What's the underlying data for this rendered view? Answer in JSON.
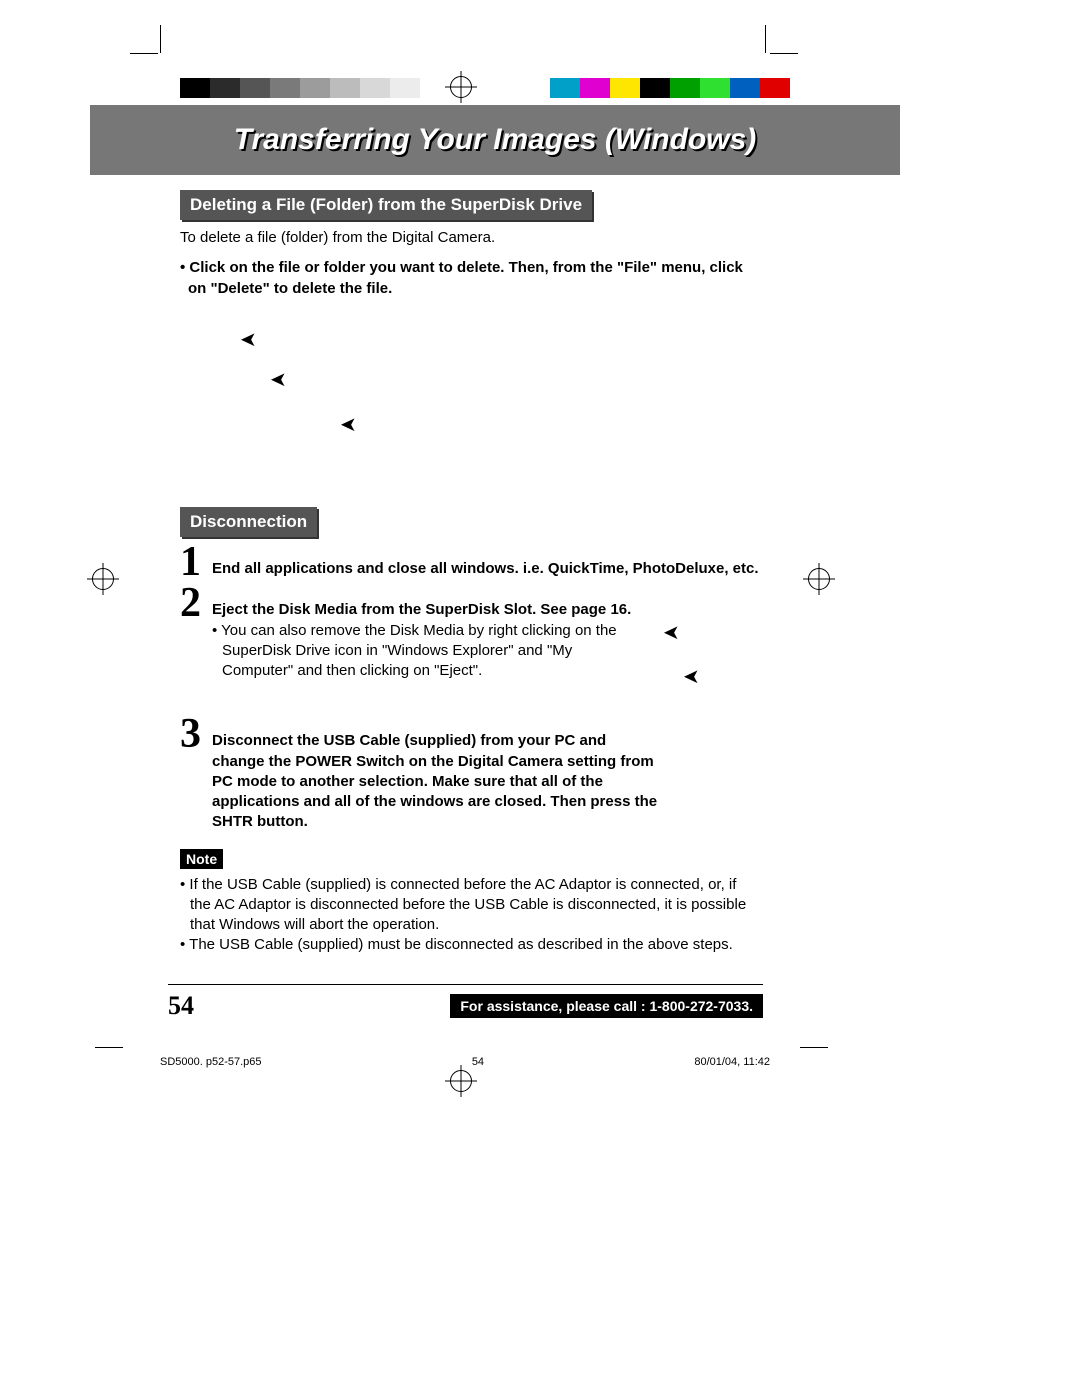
{
  "title": "Transferring Your Images (Windows)",
  "section1": {
    "heading": "Deleting a File (Folder) from the SuperDisk Drive",
    "intro": "To delete a file (folder) from the Digital Camera.",
    "bullet": "Click on the file or folder you want to delete. Then, from the  \"File\" menu, click on \"Delete\" to delete the file."
  },
  "section2": {
    "heading": "Disconnection",
    "steps": [
      {
        "num": "1",
        "bold": "End all applications and close all windows.  i.e. QuickTime, PhotoDeluxe, etc."
      },
      {
        "num": "2",
        "bold": "Eject the Disk Media from the SuperDisk Slot.  See page 16.",
        "sub": "You can also remove the Disk Media by right clicking on the SuperDisk Drive icon in \"Windows Explorer\" and \"My Computer\" and then clicking on \"Eject\"."
      },
      {
        "num": "3",
        "bold": "Disconnect  the USB Cable (supplied) from your PC and change the POWER Switch on the Digital Camera setting  from PC mode to another selection. Make sure that all of the applications and all of the windows are closed. Then press the SHTR button."
      }
    ]
  },
  "note": {
    "label": "Note",
    "bullets": [
      "If the USB Cable (supplied) is connected before the AC Adaptor is connected, or, if the AC Adaptor is disconnected before the USB Cable is disconnected, it is possible that Windows will abort the operation.",
      "The USB Cable (supplied) must be disconnected as described in the above steps."
    ]
  },
  "footer": {
    "page": "54",
    "assist": "For assistance, please call : 1-800-272-7033."
  },
  "meta": {
    "file": "SD5000. p52-57.p65",
    "pg": "54",
    "date": "80/01/04, 11:42"
  },
  "colors_left": [
    "#000",
    "#2b2b2b",
    "#555",
    "#7a7a7a",
    "#9c9c9c",
    "#bcbcbc",
    "#d8d8d8",
    "#ececec"
  ],
  "colors_right": [
    "#00a0c8",
    "#e000d0",
    "#ffe600",
    "#000",
    "#00a000",
    "#30e030",
    "#0060c0",
    "#e00000"
  ]
}
